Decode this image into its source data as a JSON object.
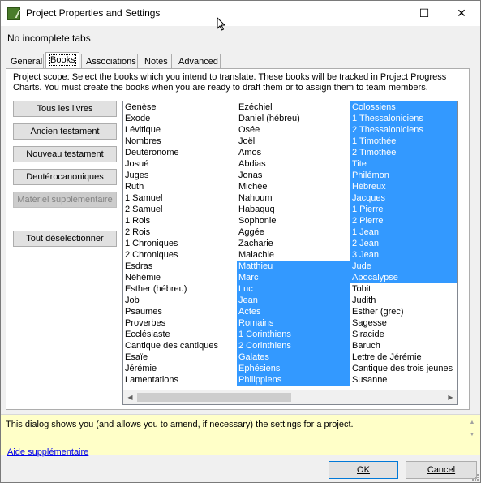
{
  "window": {
    "title": "Project Properties and Settings",
    "minimize_glyph": "—",
    "maximize_glyph": "☐",
    "close_glyph": "✕"
  },
  "status": "No incomplete tabs",
  "tabs": [
    {
      "label": "General",
      "active": false
    },
    {
      "label": "Books",
      "active": true
    },
    {
      "label": "Associations",
      "active": false
    },
    {
      "label": "Notes",
      "active": false
    },
    {
      "label": "Advanced",
      "active": false
    }
  ],
  "books_tab": {
    "scope_text": "Project scope: Select the books which you intend to translate. These books will be tracked in Project Progress Charts. You must create the books when you are ready to draft them or to assign them to team members.",
    "buttons": {
      "all": "Tous les livres",
      "ot": "Ancien testament",
      "nt": "Nouveau testament",
      "dc": "Deutérocanoniques",
      "extra": "Matériel supplémentaire",
      "deselect": "Tout désélectionner"
    },
    "columns": [
      [
        {
          "name": "Genèse",
          "selected": false
        },
        {
          "name": "Exode",
          "selected": false
        },
        {
          "name": "Lévitique",
          "selected": false
        },
        {
          "name": "Nombres",
          "selected": false
        },
        {
          "name": "Deutéronome",
          "selected": false
        },
        {
          "name": "Josué",
          "selected": false
        },
        {
          "name": "Juges",
          "selected": false
        },
        {
          "name": "Ruth",
          "selected": false
        },
        {
          "name": "1 Samuel",
          "selected": false
        },
        {
          "name": "2 Samuel",
          "selected": false
        },
        {
          "name": "1 Rois",
          "selected": false
        },
        {
          "name": "2 Rois",
          "selected": false
        },
        {
          "name": "1 Chroniques",
          "selected": false
        },
        {
          "name": "2 Chroniques",
          "selected": false
        },
        {
          "name": "Esdras",
          "selected": false
        },
        {
          "name": "Néhémie",
          "selected": false
        },
        {
          "name": "Esther (hébreu)",
          "selected": false
        },
        {
          "name": "Job",
          "selected": false
        },
        {
          "name": "Psaumes",
          "selected": false
        },
        {
          "name": "Proverbes",
          "selected": false
        },
        {
          "name": "Ecclésiaste",
          "selected": false
        },
        {
          "name": "Cantique des cantiques",
          "selected": false
        },
        {
          "name": "Esaïe",
          "selected": false
        },
        {
          "name": "Jérémie",
          "selected": false
        },
        {
          "name": "Lamentations",
          "selected": false
        }
      ],
      [
        {
          "name": "Ezéchiel",
          "selected": false
        },
        {
          "name": "Daniel (hébreu)",
          "selected": false
        },
        {
          "name": "Osée",
          "selected": false
        },
        {
          "name": "Joël",
          "selected": false
        },
        {
          "name": "Amos",
          "selected": false
        },
        {
          "name": "Abdias",
          "selected": false
        },
        {
          "name": "Jonas",
          "selected": false
        },
        {
          "name": "Michée",
          "selected": false
        },
        {
          "name": "Nahoum",
          "selected": false
        },
        {
          "name": "Habaquq",
          "selected": false
        },
        {
          "name": "Sophonie",
          "selected": false
        },
        {
          "name": "Aggée",
          "selected": false
        },
        {
          "name": "Zacharie",
          "selected": false
        },
        {
          "name": "Malachie",
          "selected": false
        },
        {
          "name": "Matthieu",
          "selected": true
        },
        {
          "name": "Marc",
          "selected": true
        },
        {
          "name": "Luc",
          "selected": true
        },
        {
          "name": "Jean",
          "selected": true
        },
        {
          "name": "Actes",
          "selected": true
        },
        {
          "name": "Romains",
          "selected": true
        },
        {
          "name": "1 Corinthiens",
          "selected": true
        },
        {
          "name": "2 Corinthiens",
          "selected": true
        },
        {
          "name": "Galates",
          "selected": true
        },
        {
          "name": "Ephésiens",
          "selected": true
        },
        {
          "name": "Philippiens",
          "selected": true
        }
      ],
      [
        {
          "name": "Colossiens",
          "selected": true
        },
        {
          "name": "1 Thessaloniciens",
          "selected": true
        },
        {
          "name": "2 Thessaloniciens",
          "selected": true
        },
        {
          "name": "1 Timothée",
          "selected": true
        },
        {
          "name": "2 Timothée",
          "selected": true
        },
        {
          "name": "Tite",
          "selected": true
        },
        {
          "name": "Philémon",
          "selected": true
        },
        {
          "name": "Hébreux",
          "selected": true
        },
        {
          "name": "Jacques",
          "selected": true
        },
        {
          "name": "1 Pierre",
          "selected": true
        },
        {
          "name": "2 Pierre",
          "selected": true
        },
        {
          "name": "1 Jean",
          "selected": true
        },
        {
          "name": "2 Jean",
          "selected": true
        },
        {
          "name": "3 Jean",
          "selected": true
        },
        {
          "name": "Jude",
          "selected": true
        },
        {
          "name": "Apocalypse",
          "selected": true
        },
        {
          "name": "Tobit",
          "selected": false
        },
        {
          "name": "Judith",
          "selected": false
        },
        {
          "name": "Esther (grec)",
          "selected": false
        },
        {
          "name": "Sagesse",
          "selected": false
        },
        {
          "name": "Siracide",
          "selected": false
        },
        {
          "name": "Baruch",
          "selected": false
        },
        {
          "name": "Lettre de Jérémie",
          "selected": false
        },
        {
          "name": "Cantique des trois jeunes",
          "selected": false
        },
        {
          "name": "Susanne",
          "selected": false
        }
      ]
    ]
  },
  "help": {
    "text": "This dialog shows you (and allows you to amend, if necessary) the settings for a project.",
    "link": "Aide supplémentaire"
  },
  "footer": {
    "ok": "OK",
    "cancel": "Cancel"
  },
  "colors": {
    "selection": "#3399ff",
    "help_background": "#ffffc8"
  }
}
